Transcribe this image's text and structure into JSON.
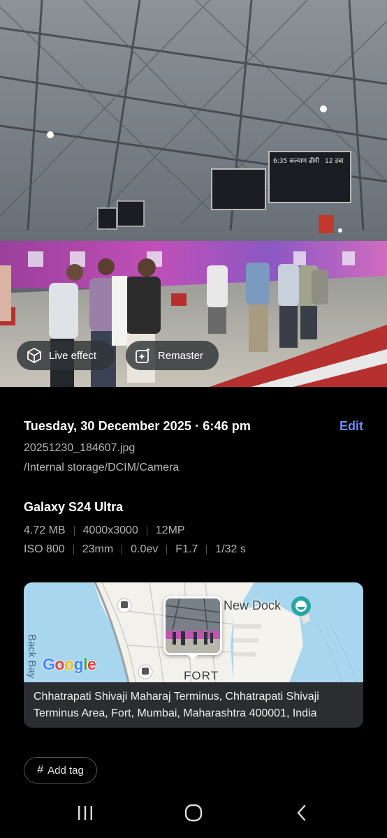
{
  "photo": {
    "board_text": [
      "6:35 कल्याण ढीमी",
      "12 डबा"
    ],
    "chips": {
      "live_effect_label": "Live effect",
      "remaster_label": "Remaster"
    }
  },
  "details": {
    "datetime": "Tuesday, 30 December 2025 · 6:46 pm",
    "edit_label": "Edit",
    "filename": "20251230_184607.jpg",
    "path": "/Internal storage/DCIM/Camera"
  },
  "camera": {
    "device": "Galaxy S24 Ultra",
    "file_size": "4.72 MB",
    "resolution": "4000x3000",
    "megapixels": "12MP",
    "iso": "ISO 800",
    "focal_length": "23mm",
    "exposure_value": "0.0ev",
    "aperture": "F1.7",
    "shutter": "1/32 s"
  },
  "map": {
    "label_new_dock": "New Dock",
    "label_fort": "FORT",
    "label_bay": "Back Bay",
    "logo_letters": [
      "G",
      "o",
      "o",
      "g",
      "l",
      "e"
    ],
    "logo_colors": [
      "#4285F4",
      "#EA4335",
      "#FBBC05",
      "#4285F4",
      "#34A853",
      "#EA4335"
    ],
    "address": "Chhatrapati Shivaji Maharaj Terminus, Chhatrapati Shivaji Terminus Area, Fort, Mumbai, Maharashtra 400001, India"
  },
  "tags": {
    "add_tag_label": "Add tag"
  },
  "navbar": {
    "recent_icon": "recent-apps-icon",
    "home_icon": "home-icon",
    "back_icon": "back-icon"
  },
  "colors": {
    "accent": "#6b8bf0",
    "background": "#000000",
    "muted_text": "#b4b4b4",
    "address_bg": "#2b2d31"
  }
}
